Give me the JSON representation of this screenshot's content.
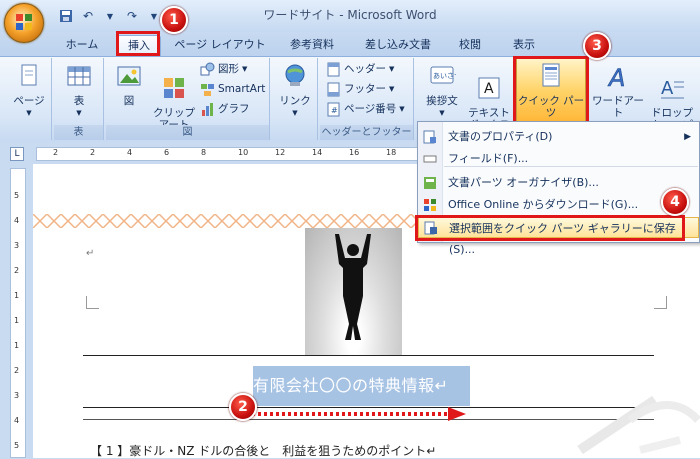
{
  "window": {
    "title": "ワードサイト - Microsoft Word"
  },
  "quick_access": {
    "icons": [
      "save-icon",
      "undo-icon",
      "redo-icon",
      "customize-icon"
    ]
  },
  "tabs": [
    {
      "label": "ホーム"
    },
    {
      "label": "挿入"
    },
    {
      "label": "ページ レイアウト"
    },
    {
      "label": "参考資料"
    },
    {
      "label": "差し込み文書"
    },
    {
      "label": "校閲"
    },
    {
      "label": "表示"
    }
  ],
  "ribbon": {
    "pages": {
      "label": "ページ"
    },
    "tables": {
      "button": "表",
      "group": "表"
    },
    "illustrations": {
      "picture": "図",
      "clipart": "クリップ\nアート",
      "shapes": "図形",
      "smartart": "SmartArt",
      "chart": "グラフ",
      "group": "図"
    },
    "links": {
      "button": "リンク"
    },
    "header_footer": {
      "header": "ヘッダー",
      "footer": "フッター",
      "page_number": "ページ番号",
      "group": "ヘッダーとフッター"
    },
    "text": {
      "greeting": "挨拶文",
      "textbox": "テキスト\nボックス",
      "quickparts": "クイック パーツ",
      "wordart": "ワードアート",
      "dropcap": "ドロップ\nキャップ"
    }
  },
  "ruler": {
    "corner": "L",
    "h_ticks": [
      "2",
      "2",
      "4",
      "6",
      "8",
      "10",
      "12",
      "14",
      "16",
      "18",
      "20",
      "22"
    ],
    "v_ticks": [
      "5",
      "4",
      "3",
      "2",
      "1",
      "1",
      "1",
      "2",
      "3",
      "4",
      "5"
    ]
  },
  "menu": {
    "items": [
      {
        "label": "文書のプロパティ(D)",
        "icon": "document-properties-icon",
        "submenu": "▶"
      },
      {
        "label": "フィールド(F)...",
        "icon": "field-icon"
      },
      {
        "label": "文書パーツ オーガナイザ(B)...",
        "icon": "building-blocks-icon"
      },
      {
        "label": "Office Online からダウンロード(G)...",
        "icon": "office-online-icon"
      },
      {
        "label": "選択範囲をクイック パーツ ギャラリーに保存(S)...",
        "icon": "save-selection-icon"
      }
    ]
  },
  "document": {
    "return_mark": "↵",
    "heading": "有限会社〇〇の特典情報↵",
    "body_line": "【 1 】豪ドル・NZ ドルの合後と　利益を狙うためのポイント↵"
  },
  "badges": [
    "1",
    "2",
    "3",
    "4"
  ],
  "colors": {
    "highlight_red": "#e0181a",
    "selection_blue": "#a7c3e4",
    "ribbon_blue": "#c9dbf0",
    "quickparts_orange": "#ffb83a"
  }
}
